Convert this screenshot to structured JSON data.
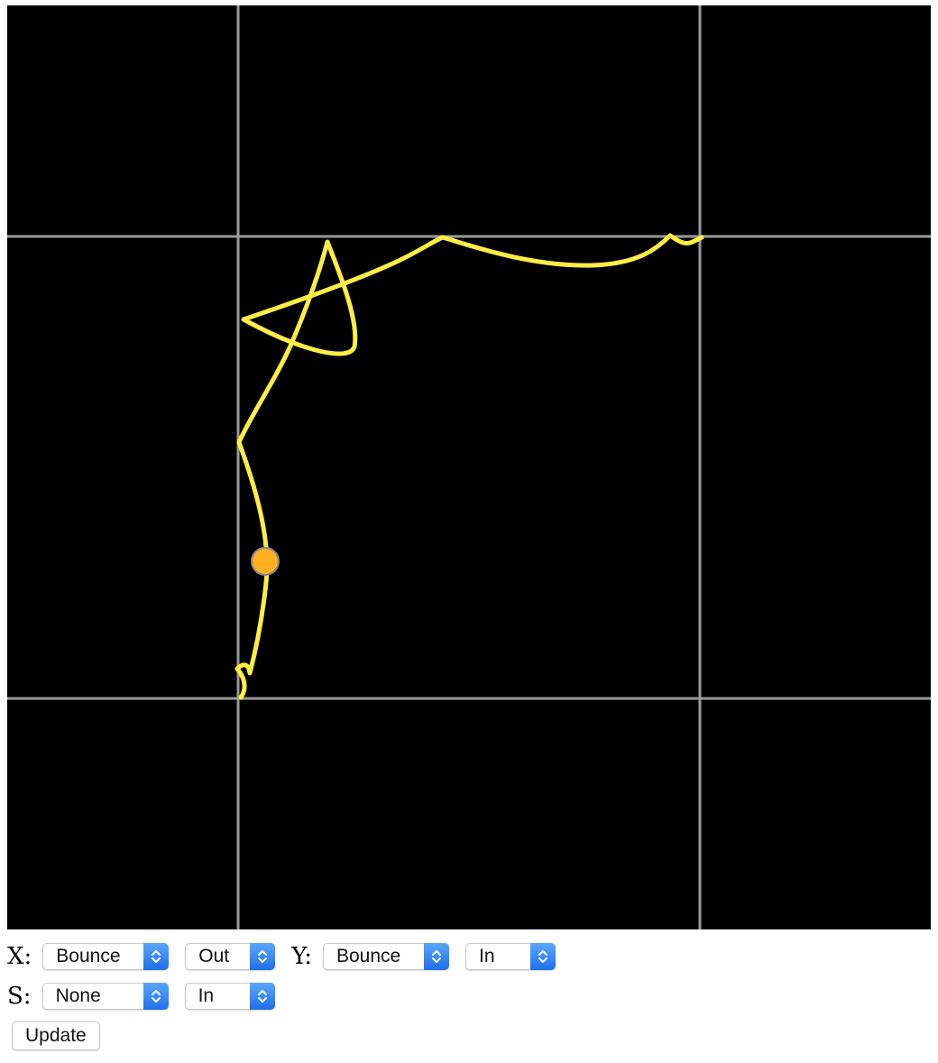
{
  "canvas": {
    "background": "#000000",
    "grid_color": "#9a9a9a",
    "path_color": "#ffee44",
    "dot_color": "#ffb020"
  },
  "controls": {
    "x": {
      "label": "X:",
      "ease": "Bounce",
      "direction": "Out"
    },
    "y": {
      "label": "Y:",
      "ease": "Bounce",
      "direction": "In"
    },
    "s": {
      "label": "S:",
      "ease": "None",
      "direction": "In"
    },
    "update_label": "Update"
  }
}
